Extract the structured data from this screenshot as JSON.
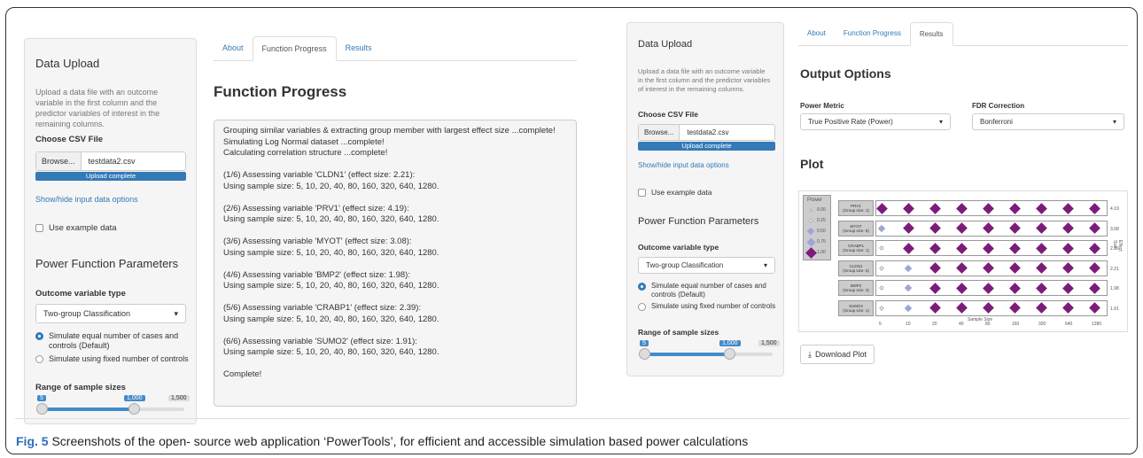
{
  "left": {
    "sidebar": {
      "data_upload_title": "Data Upload",
      "upload_help": "Upload a data file with an outcome variable in the first column and the predictor variables of interest in the remaining columns.",
      "choose_csv_label": "Choose CSV File",
      "browse_label": "Browse...",
      "file_name": "testdata2.csv",
      "upload_status": "Upload complete",
      "show_hide_link": "Show/hide input data options",
      "example_data_label": "Use example data",
      "power_params_title": "Power Function Parameters",
      "outcome_type_label": "Outcome variable type",
      "outcome_type_value": "Two-group Classification",
      "radio_equal": "Simulate equal number of cases and controls (Default)",
      "radio_fixed": "Simulate using fixed number of controls",
      "range_label": "Range of sample sizes",
      "slider_min_tag": "5",
      "slider_max_tag": "1,000",
      "slider_end_tag": "1,500"
    },
    "tabs": [
      "About",
      "Function Progress",
      "Results"
    ],
    "active_tab": "Function Progress",
    "heading": "Function Progress",
    "log_lines": [
      "Grouping similar variables & extracting group member with largest effect size ...complete!",
      "Simulating Log Normal dataset ...complete!",
      "Calculating correlation structure ...complete!",
      "",
      "(1/6) Assessing variable 'CLDN1' (effect size: 2.21):",
      "Using sample size: 5, 10, 20, 40, 80, 160, 320, 640, 1280.",
      "",
      "(2/6) Assessing variable 'PRV1' (effect size: 4.19):",
      "Using sample size: 5, 10, 20, 40, 80, 160, 320, 640, 1280.",
      "",
      "(3/6) Assessing variable 'MYOT' (effect size: 3.08):",
      "Using sample size: 5, 10, 20, 40, 80, 160, 320, 640, 1280.",
      "",
      "(4/6) Assessing variable 'BMP2' (effect size: 1.98):",
      "Using sample size: 5, 10, 20, 40, 80, 160, 320, 640, 1280.",
      "",
      "(5/6) Assessing variable 'CRABP1' (effect size: 2.39):",
      "Using sample size: 5, 10, 20, 40, 80, 160, 320, 640, 1280.",
      "",
      "(6/6) Assessing variable 'SUMO2' (effect size: 1.91):",
      "Using sample size: 5, 10, 20, 40, 80, 160, 320, 640, 1280.",
      "",
      "Complete!"
    ]
  },
  "right": {
    "sidebar": {
      "data_upload_title": "Data Upload",
      "upload_help": "Upload a data file with an outcome variable in the first column and the predictor variables of interest in the remaining columns.",
      "choose_csv_label": "Choose CSV File",
      "browse_label": "Browse...",
      "file_name": "testdata2.csv",
      "upload_status": "Upload complete",
      "show_hide_link": "Show/hide input data options",
      "example_data_label": "Use example data",
      "power_params_title": "Power Function Parameters",
      "outcome_type_label": "Outcome variable type",
      "outcome_type_value": "Two-group Classification",
      "radio_equal": "Simulate equal number of cases and controls (Default)",
      "radio_fixed": "Simulate using fixed number of controls",
      "range_label": "Range of sample sizes",
      "slider_min_tag": "5",
      "slider_max_tag": "1,000",
      "slider_end_tag": "1,500"
    },
    "tabs": [
      "About",
      "Function Progress",
      "Results"
    ],
    "active_tab": "Results",
    "output_options_title": "Output Options",
    "power_metric_label": "Power Metric",
    "power_metric_value": "True Positive Rate (Power)",
    "fdr_label": "FDR Correction",
    "fdr_value": "Bonferroni",
    "plot_title": "Plot",
    "download_label": "Download Plot",
    "plot": {
      "legend_title": "Power",
      "legend_values": [
        "0.00",
        "0.25",
        "0.50",
        "0.75",
        "1.00"
      ],
      "x_ticks": [
        "5",
        "10",
        "20",
        "40",
        "80",
        "160",
        "320",
        "640",
        "1280"
      ],
      "x_label": "Sample Size",
      "y_label": "Effect Size",
      "rows": [
        {
          "label": "PRV1",
          "group": "(Group size: 1)",
          "effect": "4.19",
          "levels": [
            4,
            4,
            4,
            4,
            4,
            4,
            4,
            4,
            4
          ]
        },
        {
          "label": "MYOT",
          "group": "(Group size: 8)",
          "effect": "3.08",
          "levels": [
            2,
            4,
            4,
            4,
            4,
            4,
            4,
            4,
            4
          ]
        },
        {
          "label": "CRABP1",
          "group": "(Group size: 1)",
          "effect": "2.39",
          "levels": [
            1,
            4,
            4,
            4,
            4,
            4,
            4,
            4,
            4
          ]
        },
        {
          "label": "CLDN1",
          "group": "(Group size: 5)",
          "effect": "2.21",
          "levels": [
            1,
            2,
            4,
            4,
            4,
            4,
            4,
            4,
            4
          ]
        },
        {
          "label": "BMP2",
          "group": "(Group size: 3)",
          "effect": "1.98",
          "levels": [
            1,
            2,
            4,
            4,
            4,
            4,
            4,
            4,
            4
          ]
        },
        {
          "label": "SUMO2",
          "group": "(Group size: 1)",
          "effect": "1.91",
          "levels": [
            1,
            2,
            4,
            4,
            4,
            4,
            4,
            4,
            4
          ]
        }
      ]
    }
  },
  "caption": {
    "label": "Fig. 5",
    "text": "Screenshots of the open- source web application ‘PowerTools’, for efficient and accessible simulation based power calculations"
  }
}
